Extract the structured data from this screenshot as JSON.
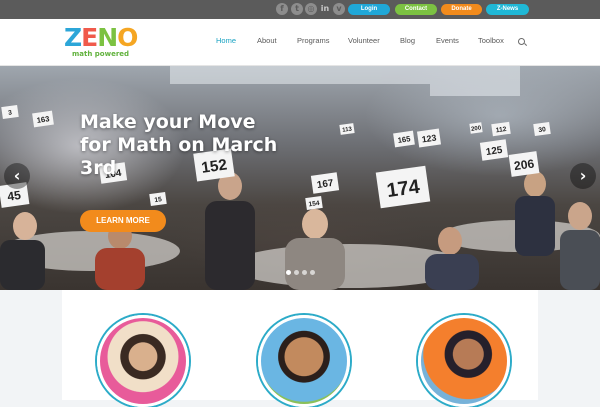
{
  "topbar": {
    "social": [
      {
        "icon": "facebook-icon",
        "glyph": "f"
      },
      {
        "icon": "twitter-icon",
        "glyph": "t"
      },
      {
        "icon": "instagram-icon",
        "glyph": "◎"
      },
      {
        "icon": "linkedin-icon",
        "glyph": "in"
      },
      {
        "icon": "vimeo-icon",
        "glyph": "v"
      }
    ],
    "buttons": [
      {
        "label": "Login",
        "color": "#20a8d8"
      },
      {
        "label": "Contact",
        "color": "#7cc242"
      },
      {
        "label": "Donate",
        "color": "#f28b1c"
      },
      {
        "label": "Z-News",
        "color": "#20b8d6"
      }
    ]
  },
  "header": {
    "logo": {
      "word": "ZENO",
      "tagline": "math powered",
      "colors": [
        "#2ca6d8",
        "#f05a4b",
        "#7cc242",
        "#f5a623"
      ]
    },
    "nav": [
      "Home",
      "About",
      "Programs",
      "Volunteer",
      "Blog",
      "Events",
      "Toolbox"
    ],
    "active": "Home"
  },
  "hero": {
    "title": "Make your Move for Math on March 3rd",
    "cta": "LEARN MORE",
    "prev": "‹",
    "next": "›",
    "slides": 4,
    "current": 1,
    "cards": [
      "3",
      "163",
      "104",
      "152",
      "167",
      "174",
      "123",
      "165",
      "125",
      "206",
      "112",
      "30",
      "45",
      "113",
      "200",
      "1_5",
      "154"
    ]
  },
  "colors": {
    "accent": "#18a2c2",
    "cta": "#f28b1c",
    "ring": "#2cabc8"
  }
}
